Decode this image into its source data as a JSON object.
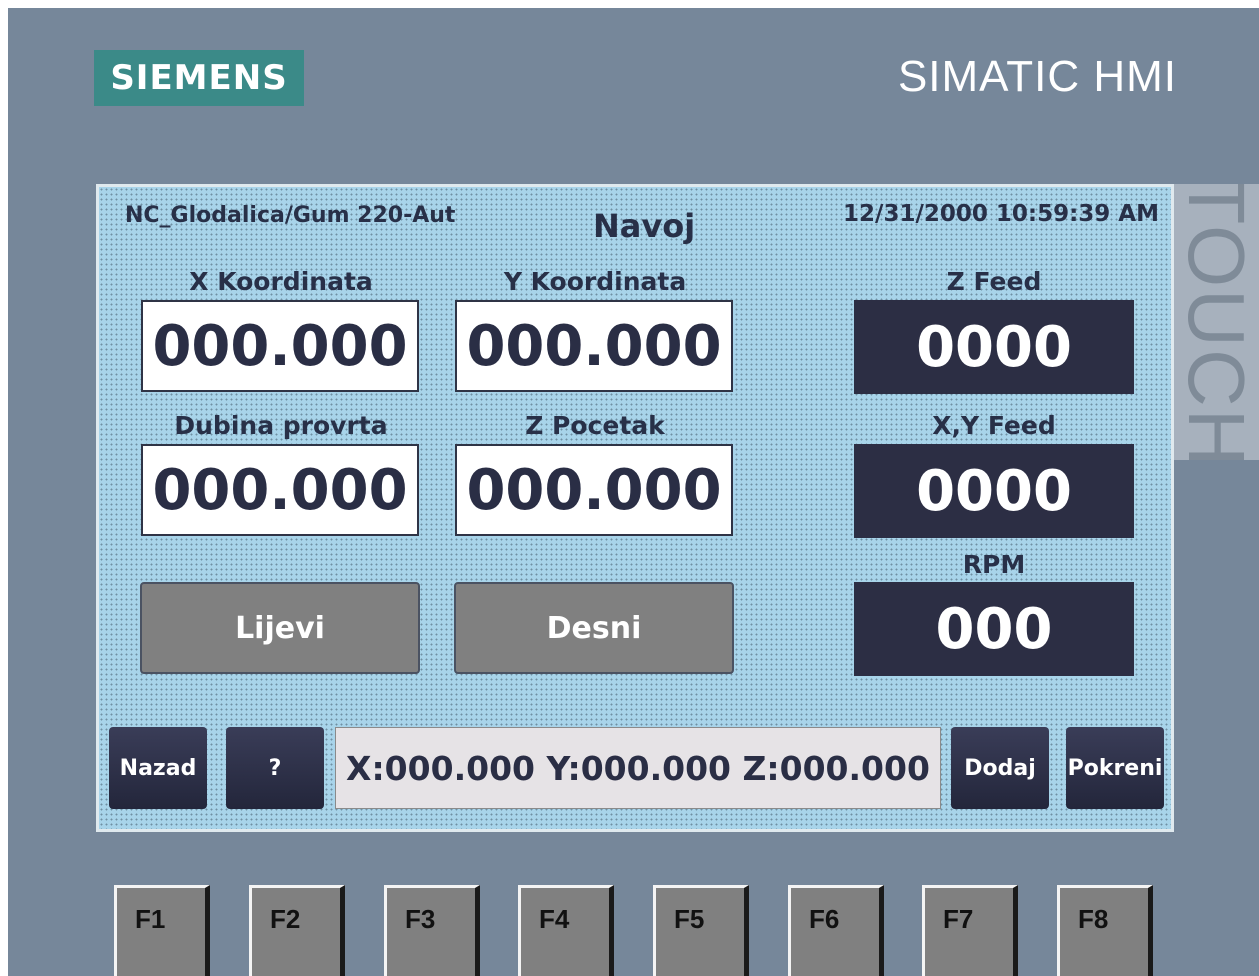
{
  "device": {
    "logo": "SIEMENS",
    "brand": "SIMATIC HMI",
    "touch_label": "TOUCH"
  },
  "screen": {
    "project": "NC_Glodalica/Gum 220-Aut",
    "title": "Navoj",
    "datetime": "12/31/2000 10:59:39 AM",
    "fields": {
      "x": {
        "label": "X Koordinata",
        "value": "000.000"
      },
      "y": {
        "label": "Y Koordinata",
        "value": "000.000"
      },
      "depth": {
        "label": "Dubina provrta",
        "value": "000.000"
      },
      "zstart": {
        "label": "Z Pocetak",
        "value": "000.000"
      }
    },
    "feeds": {
      "z_feed": {
        "label": "Z Feed",
        "value": "0000"
      },
      "xy_feed": {
        "label": "X,Y Feed",
        "value": "0000"
      },
      "rpm": {
        "label": "RPM",
        "value": "000"
      }
    },
    "buttons": {
      "left": "Lijevi",
      "right": "Desni",
      "back": "Nazad",
      "help": "?",
      "add": "Dodaj",
      "start": "Pokreni"
    },
    "coords_display": "X:000.000 Y:000.000 Z:000.000"
  },
  "function_keys": [
    "F1",
    "F2",
    "F3",
    "F4",
    "F5",
    "F6",
    "F7",
    "F8"
  ],
  "colors": {
    "panel": "#76879a",
    "screen": "#a8d4ea",
    "dark_display": "#2c2e44",
    "logo": "#3b8a88"
  }
}
